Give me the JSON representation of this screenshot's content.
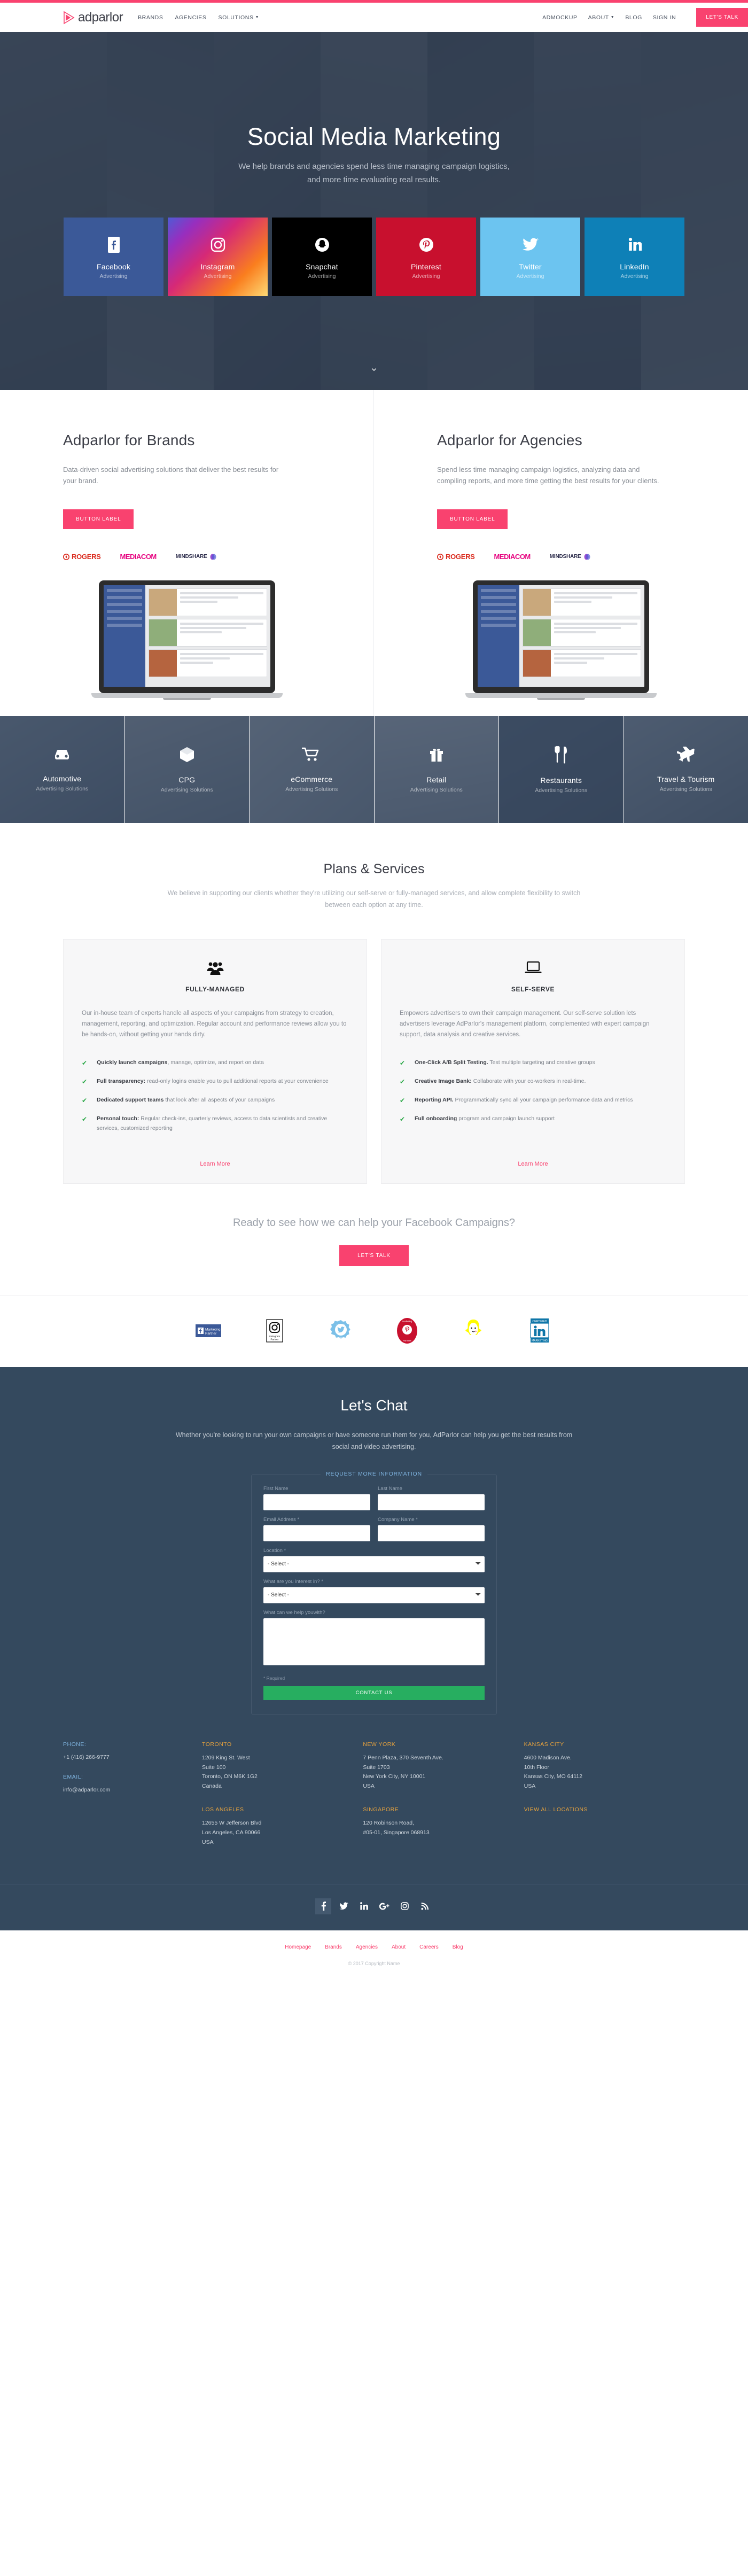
{
  "nav": {
    "brand": "adparlor",
    "left": [
      {
        "label": "BRANDS",
        "caret": false
      },
      {
        "label": "AGENCIES",
        "caret": false
      },
      {
        "label": "SOLUTIONS",
        "caret": true
      }
    ],
    "right": [
      {
        "label": "ADMOCKUP",
        "caret": false
      },
      {
        "label": "ABOUT",
        "caret": true
      },
      {
        "label": "BLOG",
        "caret": false
      },
      {
        "label": "SIGN IN",
        "caret": false
      }
    ],
    "cta": "LET'S TALK"
  },
  "hero": {
    "title": "Social Media Marketing",
    "subtitle_line1": "We help brands and agencies spend less time managing campaign logistics,",
    "subtitle_line2": "and more time evaluating real results.",
    "tiles": [
      {
        "name": "Facebook",
        "sub": "Advertising",
        "icon": "facebook-icon",
        "cls": "t-fb"
      },
      {
        "name": "Instagram",
        "sub": "Advertising",
        "icon": "instagram-icon",
        "cls": "t-ig"
      },
      {
        "name": "Snapchat",
        "sub": "Advertising",
        "icon": "snapchat-icon",
        "cls": "t-sc"
      },
      {
        "name": "Pinterest",
        "sub": "Advertising",
        "icon": "pinterest-icon",
        "cls": "t-pi"
      },
      {
        "name": "Twitter",
        "sub": "Advertising",
        "icon": "twitter-icon",
        "cls": "t-tw"
      },
      {
        "name": "LinkedIn",
        "sub": "Advertising",
        "icon": "linkedin-icon",
        "cls": "t-li"
      }
    ]
  },
  "brands_col": {
    "heading": "Adparlor for Brands",
    "desc": "Data-driven social advertising solutions that deliver the best results for your brand.",
    "button": "BUTTON LABEL",
    "clients": [
      "ROGERS",
      "MEDIACOM",
      "MINDSHARE"
    ]
  },
  "agencies_col": {
    "heading": "Adparlor for Agencies",
    "desc": "Spend less time managing campaign logistics, analyzing data and compiling reports, and more time getting the best results for your clients.",
    "button": "BUTTON LABEL",
    "clients": [
      "ROGERS",
      "MEDIACOM",
      "MINDSHARE"
    ]
  },
  "industries": [
    {
      "title": "Automotive",
      "sub": "Advertising Solutions",
      "icon": "car-icon"
    },
    {
      "title": "CPG",
      "sub": "Advertising Solutions",
      "icon": "box-icon"
    },
    {
      "title": "eCommerce",
      "sub": "Advertising Solutions",
      "icon": "cart-icon"
    },
    {
      "title": "Retail",
      "sub": "Advertising Solutions",
      "icon": "gift-icon"
    },
    {
      "title": "Restaurants",
      "sub": "Advertising Solutions",
      "icon": "cutlery-icon"
    },
    {
      "title": "Travel & Tourism",
      "sub": "Advertising Solutions",
      "icon": "plane-icon"
    }
  ],
  "plans": {
    "heading": "Plans & Services",
    "lede": "We believe in supporting our clients whether they're utilizing our self-serve or fully-managed services, and allow complete flexibility to switch between each option at any time.",
    "cards": [
      {
        "icon": "people-group-icon",
        "title": "FULLY-MANAGED",
        "desc": "Our in-house team of experts handle all aspects of your campaigns from strategy to creation, management, reporting, and optimization. Regular account and performance reviews allow you to be hands-on, without getting your hands dirty.",
        "features": [
          {
            "bold": "Quickly launch campaigns",
            "rest": ", manage, optimize, and report on data"
          },
          {
            "bold": "Full transparency:",
            "rest": " read-only logins enable you to pull additional reports at your convenience"
          },
          {
            "bold": "Dedicated support teams",
            "rest": " that look after all aspects of your campaigns"
          },
          {
            "bold": "Personal touch:",
            "rest": " Regular check-ins, quarterly reviews, access to data scientists and creative services, customized reporting"
          }
        ],
        "learn_more": "Learn More"
      },
      {
        "icon": "laptop-icon",
        "title": "SELF-SERVE",
        "desc": "Empowers advertisers to own their campaign management. Our self-serve solution lets advertisers leverage AdParlor's management platform, complemented with expert campaign support, data analysis and creative services.",
        "features": [
          {
            "bold": "One-Click A/B Split Testing.",
            "rest": " Test multiple targeting and creative groups"
          },
          {
            "bold": "Creative Image Bank:",
            "rest": " Collaborate with your co-workers in real-time."
          },
          {
            "bold": "Reporting API.",
            "rest": "  Programmatically sync all your campaign performance data and metrics"
          },
          {
            "bold": "Full onboarding",
            "rest": " program and campaign launch support"
          }
        ],
        "learn_more": "Learn More"
      }
    ]
  },
  "ready": {
    "heading": "Ready to see how we can help your Facebook Campaigns?",
    "button": "LET'S TALK"
  },
  "partners": [
    {
      "name": "facebook-marketing-partner-badge",
      "label": "Marketing Partner"
    },
    {
      "name": "instagram-partner-badge",
      "label": "Instagram Partner"
    },
    {
      "name": "twitter-official-partner-badge",
      "label": "Official Partner"
    },
    {
      "name": "pinterest-marketing-partner-badge",
      "label": "Marketing Partners"
    },
    {
      "name": "snapchat-partner-badge",
      "label": "Snapchat"
    },
    {
      "name": "linkedin-certified-marketing-badge",
      "label": "CERTIFIED"
    }
  ],
  "chat": {
    "heading": "Let's Chat",
    "lede": "Whether you're looking to run your own campaigns or have someone run them for you, AdParlor can help you get the best results from social and video advertising.",
    "form": {
      "legend": "REQUEST MORE INFORMATION",
      "first_name_label": "First Name",
      "first_name_value": "",
      "last_name_label": "Last Name",
      "last_name_value": "",
      "email_label": "Email Address *",
      "email_value": "",
      "company_label": "Company Name *",
      "company_value": "",
      "location_label": "Location *",
      "location_value": "- Select -",
      "interest_label": "What are you interest in? *",
      "interest_value": "- Select -",
      "help_label": "What can we help youwith?",
      "help_value": "",
      "required_note": "* Required",
      "submit": "CONTACT US"
    }
  },
  "footer": {
    "phone_label": "PHONE:",
    "phone_value": "+1 (416) 266-9777",
    "email_label": "EMAIL:",
    "email_value": "info@adparlor.com",
    "offices": [
      {
        "city": "TORONTO",
        "lines": [
          "1209 King St. West",
          "Suite 100",
          "Toronto, ON M6K 1G2",
          "Canada"
        ]
      },
      {
        "city": "NEW YORK",
        "lines": [
          "7 Penn Plaza, 370 Seventh Ave.",
          "Suite 1703",
          "New York City, NY 10001",
          "USA"
        ]
      },
      {
        "city": "KANSAS CITY",
        "lines": [
          "4600 Madison Ave.",
          "10th Floor",
          "Kansas City, MO 64112",
          "USA"
        ]
      },
      {
        "city": "LOS ANGELES",
        "lines": [
          "12655 W Jefferson Blvd",
          "Los Angeles, CA 90066",
          "USA"
        ]
      },
      {
        "city": "SINGAPORE",
        "lines": [
          "120 Robinson Road,",
          "#05-01, Singapore 068913"
        ]
      }
    ],
    "view_all": "VIEW ALL LOCATIONS",
    "social": [
      "facebook-icon",
      "twitter-icon",
      "linkedin-icon",
      "google-plus-icon",
      "instagram-icon",
      "rss-icon"
    ],
    "links": [
      "Homepage",
      "Brands",
      "Agencies",
      "About",
      "Careers",
      "Blog"
    ],
    "copyright": "© 2017 Copyright Name"
  },
  "colors": {
    "accent_pink": "#f9426f",
    "dark_navy": "#34495e",
    "green": "#27ae60",
    "orange": "#e8a33d",
    "light_blue": "#7fb4e0"
  }
}
